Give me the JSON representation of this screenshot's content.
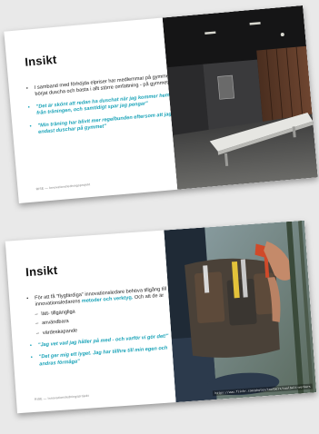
{
  "slides": [
    {
      "title": "Insikt",
      "bullets": [
        {
          "text": "I samband med förhöjda elpriser har medlemmar på gymmen börjat duscha och basta i allt större omfattning - på gymmet.",
          "style": "normal"
        },
        {
          "text": "\"Det är skönt att redan ha duschat när jag kommer hem från träningen, och samtidigt spar jag pengar\"",
          "style": "quote"
        },
        {
          "text": "\"Min träning har blivit mer regelbunden eftersom att jag endast duschar på gymmet\"",
          "style": "quote"
        }
      ],
      "footer": "RISE — Innovationsledningsprojekt",
      "photo": "locker-room-shower"
    },
    {
      "title": "Insikt",
      "intro_prefix": "För att få \"flygfärdiga\" innovationsledare",
      "intro_middle": " behöva tillgång till innovationsledarens",
      "intro_link": " metoder och verktyg.",
      "intro_suffix": " Och att de är",
      "sub_items": [
        "lätt- tillgängliga",
        "användbara",
        "värdeskapande"
      ],
      "quotes": [
        "\"Jag vet vad jag håller på med - och varför vi gör det!\"",
        "\"Det ger mig ett lyget. Jag har tillhre till min egen och andras förmåga\""
      ],
      "footer": "RISE — Innovationsledningsprojekt",
      "photo": "tool-belt",
      "credit": "https://www.flickr.com/photos/toolbelt/toolbelt-workers"
    }
  ]
}
